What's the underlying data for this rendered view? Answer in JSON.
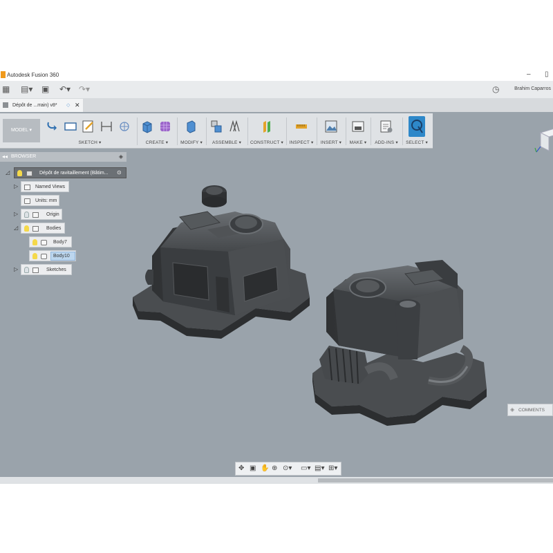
{
  "window": {
    "title": "Autodesk Fusion 360",
    "minimize": "–",
    "restore": "▯"
  },
  "quick_access": {
    "user_name": "Brahim Caparros"
  },
  "document_tab": {
    "label": "Dépôt de ...rrain) v8*"
  },
  "toolbar": {
    "workspace_label": "MODEL ▾",
    "groups": [
      "SKETCH ▾",
      "CREATE ▾",
      "MODIFY ▾",
      "ASSEMBLE ▾",
      "CONSTRUCT ▾",
      "INSPECT ▾",
      "INSERT ▾",
      "MAKE ▾",
      "ADD-INS ▾",
      "SELECT ▾"
    ],
    "active_tool": "SELECT"
  },
  "browser": {
    "title": "BROWSER",
    "collapse_icon": "◂◂",
    "pin_icon": "◈",
    "tree": {
      "root": "Dépôt de ravitaillement (Bâtim...",
      "named_views": "Named Views",
      "units": "Units: mm",
      "origin": "Origin",
      "bodies": "Bodies",
      "body7": "Body7",
      "body10": "Body10",
      "sketches": "Sketches"
    }
  },
  "comments": {
    "label": "COMMENTS"
  },
  "colors": {
    "viewport_bg": "#9aa3ab",
    "model_dark": "#3f4245",
    "accent_blue": "#2e88c9",
    "fusion_orange": "#f09a1c"
  },
  "icons": [
    "grid-menu-icon",
    "file-icon",
    "save-icon",
    "undo-icon",
    "redo-icon",
    "clock-icon",
    "close-icon",
    "pan-icon",
    "orbit-icon",
    "look-at-icon",
    "zoom-icon",
    "fit-icon",
    "display-settings-icon",
    "visual-style-icon",
    "grid-icon"
  ]
}
